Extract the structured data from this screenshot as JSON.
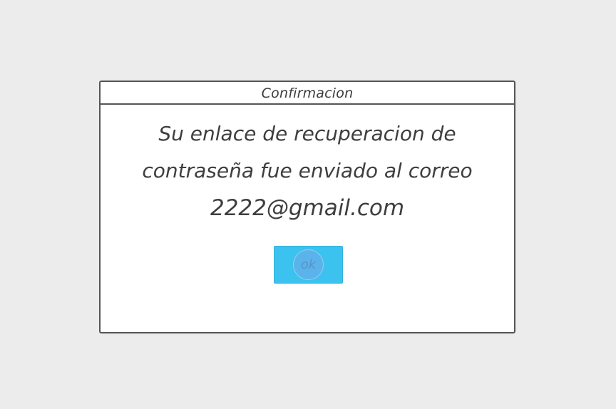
{
  "dialog": {
    "title": "Confirmacion",
    "message_lines": [
      "Su enlace de recuperacion de",
      "contraseña fue enviado al correo"
    ],
    "email": "2222@gmail.com",
    "ok_label": "ok"
  },
  "colors": {
    "background": "#ececec",
    "dialog_background": "#ffffff",
    "border": "#555555",
    "button": "#3cc2ef"
  }
}
